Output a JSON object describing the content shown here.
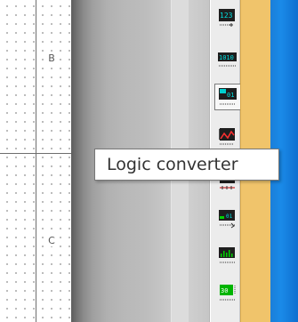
{
  "schematic": {
    "zone_labels": [
      "B",
      "C"
    ]
  },
  "toolbar": {
    "buttons": [
      {
        "name": "word-generator-icon"
      },
      {
        "name": "logic-analyzer-icon"
      },
      {
        "name": "logic-converter-icon",
        "active": true
      },
      {
        "name": "iv-analyzer-icon"
      },
      {
        "name": "distortion-analyzer-icon"
      },
      {
        "name": "spectrum-analyzer-icon"
      },
      {
        "name": "network-analyzer-icon"
      },
      {
        "name": "frequency-counter-icon"
      }
    ]
  },
  "tooltip": {
    "text": "Logic converter"
  },
  "colors": {
    "window_border": "#f0c46b",
    "desktop": "#1a8ae8",
    "icon_teal": "#00c8c8",
    "icon_green": "#00d000"
  }
}
